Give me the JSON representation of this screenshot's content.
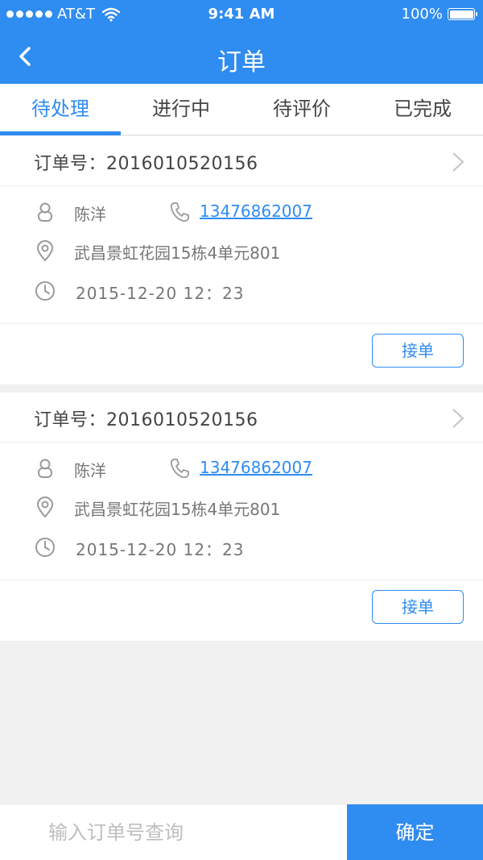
{
  "status_bar": {
    "carrier": "AT&T",
    "time": "9:41 AM",
    "battery": "100%"
  },
  "nav": {
    "title": "订单"
  },
  "tabs": [
    {
      "label": "待处理",
      "active": true
    },
    {
      "label": "进行中",
      "active": false
    },
    {
      "label": "待评价",
      "active": false
    },
    {
      "label": "已完成",
      "active": false
    }
  ],
  "orders": [
    {
      "order_no": "订单号：2016010520156",
      "name": "陈洋",
      "phone": "13476862007",
      "address": "武昌景虹花园15栋4单元801",
      "time": "2015-12-20  12：23",
      "accept_label": "接单"
    },
    {
      "order_no": "订单号：2016010520156",
      "name": "陈洋",
      "phone": "13476862007",
      "address": "武昌景虹花园15栋4单元801",
      "time": "2015-12-20  12：23",
      "accept_label": "接单"
    }
  ],
  "bottom": {
    "search_placeholder": "输入订单号查询",
    "confirm_label": "确定"
  },
  "colors": {
    "accent": "#2f8cf0",
    "background": "#f1f1f1"
  }
}
